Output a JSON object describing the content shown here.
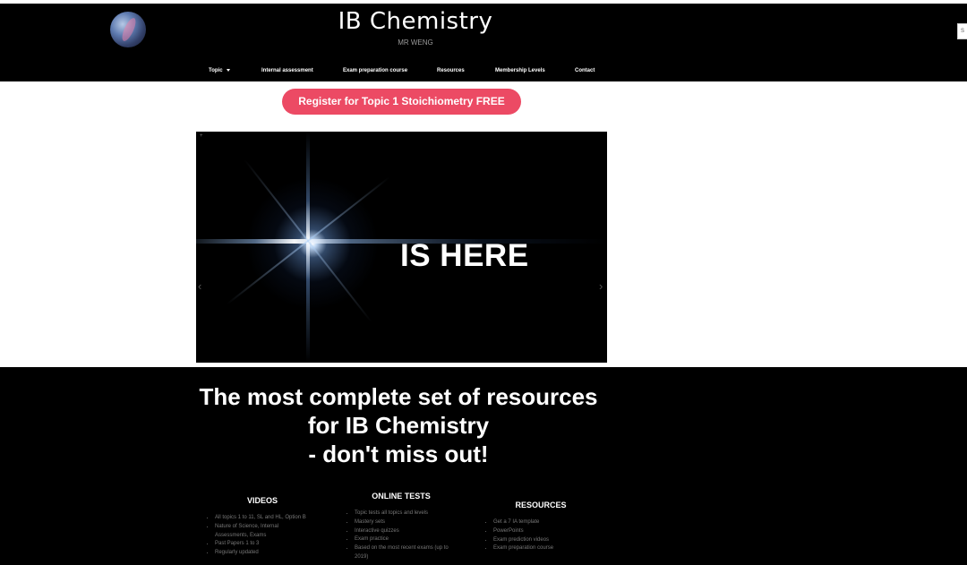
{
  "header": {
    "title": "IB Chemistry",
    "subtitle": "MR WENG",
    "logo_icon": "orb-logo-icon",
    "search_placeholder": "S"
  },
  "nav": {
    "items": [
      {
        "label": "Topic",
        "has_dropdown": true
      },
      {
        "label": "Internal assessment"
      },
      {
        "label": "Exam preparation course"
      },
      {
        "label": "Resources"
      },
      {
        "label": "Membership Levels"
      },
      {
        "label": "Contact"
      }
    ]
  },
  "cta": {
    "label": "Register for Topic 1 Stoichiometry FREE",
    "color": "#ec4a64"
  },
  "slider": {
    "headline": "IS HERE",
    "prev_icon": "‹",
    "next_icon": "›",
    "play_icon": "+"
  },
  "promo": {
    "lines": [
      "The most complete set of resources",
      "for IB Chemistry",
      "- don't miss out!"
    ],
    "columns": [
      {
        "title": "VIDEOS",
        "items": [
          "All topics 1 to 11, SL and HL, Option B",
          "Nature of Science, Internal",
          "Assessments, Exams",
          "Past Papers 1 to 3",
          "Regularly updated"
        ]
      },
      {
        "title": "ONLINE TESTS",
        "items": [
          "Topic tests all topics and levels",
          "Mastery sets",
          "Interactive quizzes",
          "Exam practice",
          "Based on the most recent exams (up to",
          "2019)"
        ]
      },
      {
        "title": "RESOURCES",
        "items": [
          "Get a 7 IA template",
          "PowerPoints",
          "Exam prediction videos",
          "Exam preparation course"
        ]
      }
    ]
  },
  "colors": {
    "header_bg": "#000000",
    "promo_bg": "#000000",
    "accent": "#ec4a64"
  }
}
